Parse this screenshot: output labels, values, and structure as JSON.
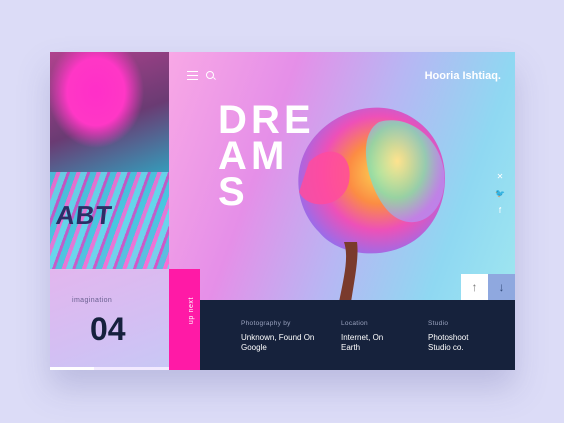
{
  "header": {
    "brand": "Hooria Ishtiaq."
  },
  "hero": {
    "title_letters": [
      "D",
      "R",
      "E",
      "A",
      "M",
      "S"
    ]
  },
  "left": {
    "shirt_text": "ABT"
  },
  "imagination": {
    "label": "imagination",
    "number": "04",
    "progress": 0.37
  },
  "upnext": {
    "label": "up next"
  },
  "info": [
    {
      "heading": "Photography by",
      "value": "Unknown, Found On Google"
    },
    {
      "heading": "Location",
      "value": "Internet, On Earth"
    },
    {
      "heading": "Studio",
      "value": "Photoshoot Studio co."
    }
  ],
  "social": [
    "pinterest-icon",
    "twitter-icon",
    "facebook-icon"
  ],
  "colors": {
    "accent": "#ff1aa6",
    "dark": "#16223c",
    "background": "#dcdcf7"
  }
}
